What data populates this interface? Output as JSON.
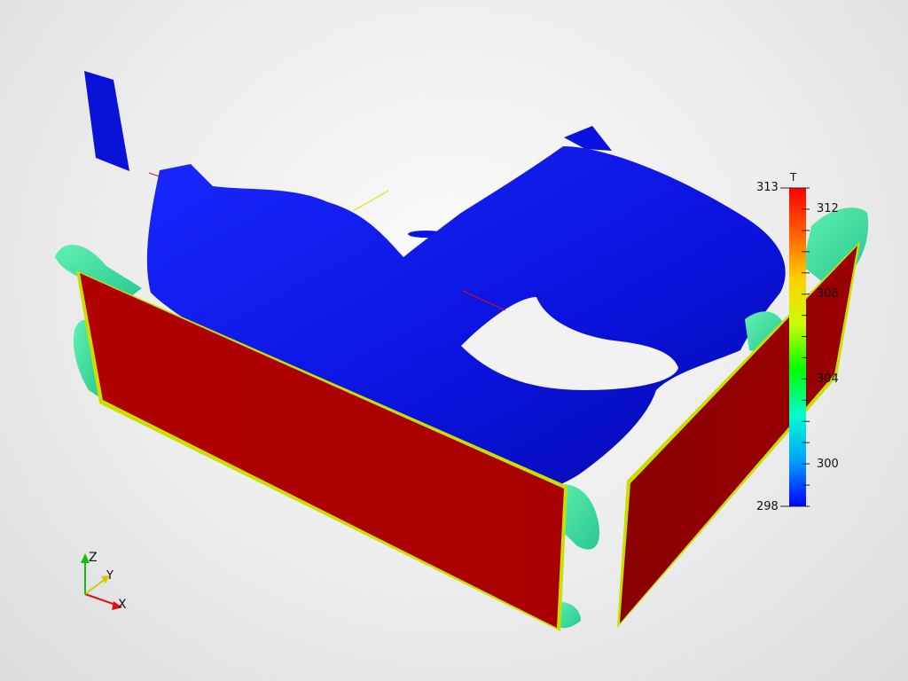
{
  "scalar_bar": {
    "title": "T",
    "range_min": 298,
    "range_max": 313,
    "max_label": "313",
    "min_label": "298",
    "tick_labels": [
      "312",
      "308",
      "304",
      "300"
    ],
    "colors": [
      "#0000ff",
      "#00a0ff",
      "#00ffd0",
      "#00ff00",
      "#c8ff00",
      "#ffd000",
      "#ff6000",
      "#ff0000"
    ]
  },
  "axes": {
    "x_label": "X",
    "y_label": "Y",
    "z_label": "Z",
    "x_color": "#e01010",
    "y_color": "#d8c800",
    "z_color": "#10c010"
  },
  "scene": {
    "cold_color": "#0a14e6",
    "hot_color": "#b40000",
    "mid_color": "#40e8a0",
    "edge_color": "#b8e000"
  }
}
